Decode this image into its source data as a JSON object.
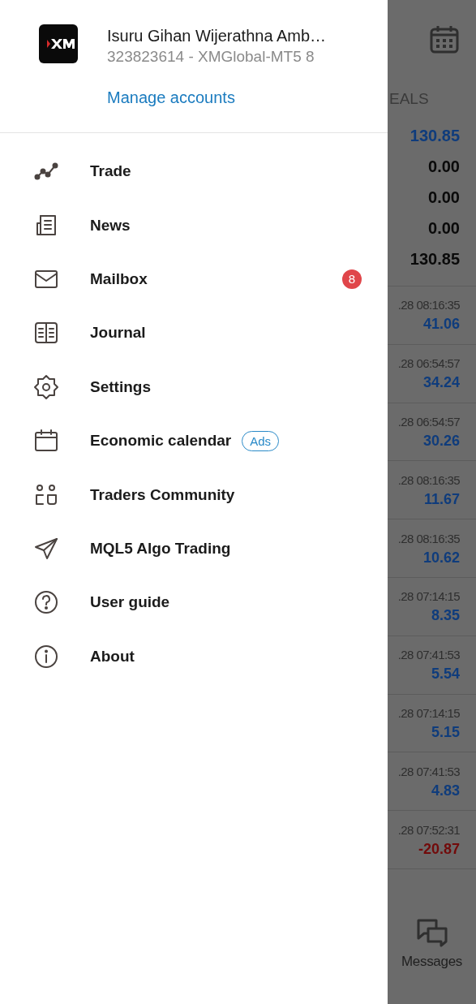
{
  "drawer": {
    "account": {
      "name": "Isuru Gihan Wijerathna Amb…",
      "number": "323823614 - XMGlobal-MT5 8",
      "manage_link": "Manage accounts"
    },
    "menu": [
      {
        "label": "Trade"
      },
      {
        "label": "News"
      },
      {
        "label": "Mailbox",
        "badge": "8"
      },
      {
        "label": "Journal"
      },
      {
        "label": "Settings"
      },
      {
        "label": "Economic calendar",
        "tag": "Ads"
      },
      {
        "label": "Traders Community"
      },
      {
        "label": "MQL5 Algo Trading"
      },
      {
        "label": "User guide"
      },
      {
        "label": "About"
      }
    ]
  },
  "background_screen": {
    "section_label": "EALS",
    "summary": [
      {
        "value": "130.85",
        "kind": "positive"
      },
      {
        "value": "0.00",
        "kind": "neutral"
      },
      {
        "value": "0.00",
        "kind": "neutral"
      },
      {
        "value": "0.00",
        "kind": "neutral"
      },
      {
        "value": "130.85",
        "kind": "neutral"
      }
    ],
    "deals": [
      {
        "time": ".28 08:16:35",
        "profit": "41.06",
        "kind": "positive"
      },
      {
        "time": ".28 06:54:57",
        "profit": "34.24",
        "kind": "positive"
      },
      {
        "time": ".28 06:54:57",
        "profit": "30.26",
        "kind": "positive"
      },
      {
        "time": ".28 08:16:35",
        "profit": "11.67",
        "kind": "positive"
      },
      {
        "time": ".28 08:16:35",
        "profit": "10.62",
        "kind": "positive"
      },
      {
        "time": ".28 07:14:15",
        "profit": "8.35",
        "kind": "positive"
      },
      {
        "time": ".28 07:41:53",
        "profit": "5.54",
        "kind": "positive"
      },
      {
        "time": ".28 07:14:15",
        "profit": "5.15",
        "kind": "positive"
      },
      {
        "time": ".28 07:41:53",
        "profit": "4.83",
        "kind": "positive"
      },
      {
        "time": ".28 07:52:31",
        "profit": "-20.87",
        "kind": "negative"
      }
    ],
    "bottom_nav": {
      "label": "Messages"
    }
  }
}
